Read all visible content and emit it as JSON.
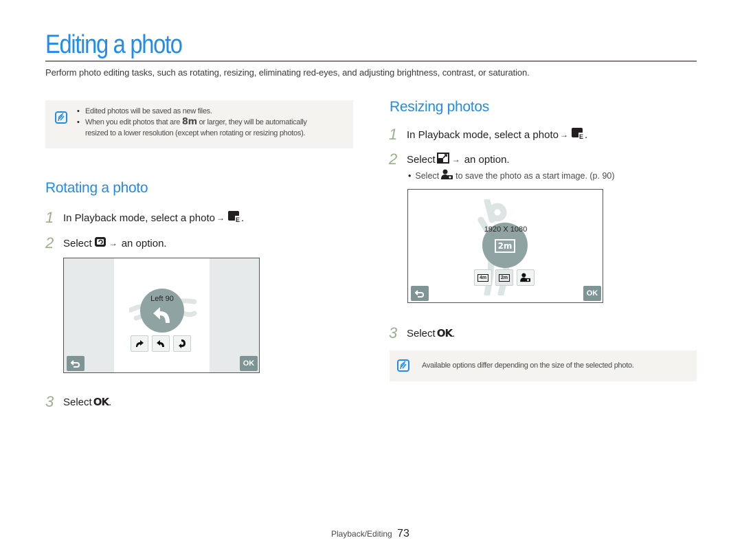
{
  "page": {
    "title": "Editing a photo",
    "intro": "Perform photo editing tasks, such as rotating, resizing, eliminating red-eyes, and adjusting brightness, contrast, or saturation.",
    "accent_color": "#1e8cf0"
  },
  "note_top": {
    "icon": "note-icon",
    "bullet1": "Edited photos will be saved as new files.",
    "bullet2_pre": "When you edit photos that are",
    "bullet2_icon_text": "8m",
    "bullet2_post": "or larger, they will be automatically",
    "bullet2_line2": "resized to a lower resolution (except when rotating or resizing photos)."
  },
  "rotating": {
    "title": "Rotating a photo",
    "step1_num": "1",
    "step1_text": "In Playback mode, select a photo",
    "step1_arrow": "→",
    "step2_num": "2",
    "step2_pre": "Select",
    "step2_arrow": "→",
    "step2_post": "an option.",
    "screen": {
      "label": "Left 90",
      "back_icon": "back-icon",
      "ok_label": "OK",
      "options": [
        "rotate-right-icon",
        "rotate-left-icon",
        "rotate-180-icon"
      ]
    },
    "step3_num": "3",
    "step3_pre": "Select",
    "step3_ok": "OK",
    "step3_post": "."
  },
  "resizing": {
    "title": "Resizing photos",
    "step1_num": "1",
    "step1_text": "In Playback mode, select a photo",
    "step1_arrow": "→",
    "step2_num": "2",
    "step2_pre": "Select",
    "step2_arrow": "→",
    "step2_post": "an option.",
    "bullet_pre": "Select",
    "bullet_post": "to save the photo as a start image. (p. 90)",
    "screen": {
      "label": "1920 X 1080",
      "size_badge": "2m",
      "back_icon": "back-icon",
      "ok_label": "OK",
      "options": [
        {
          "icon": "size-4m-icon",
          "text": "4m"
        },
        {
          "icon": "size-2m-icon",
          "text": "2m",
          "selected": true
        },
        {
          "icon": "start-image-icon",
          "text": ""
        }
      ]
    },
    "step3_num": "3",
    "step3_pre": "Select",
    "step3_ok": "OK",
    "step3_post": "."
  },
  "note_bottom": {
    "icon": "note-icon",
    "text": "Available options differ depending on the size of the selected photo."
  },
  "footer": {
    "section": "Playback/Editing",
    "page_number": "73"
  }
}
